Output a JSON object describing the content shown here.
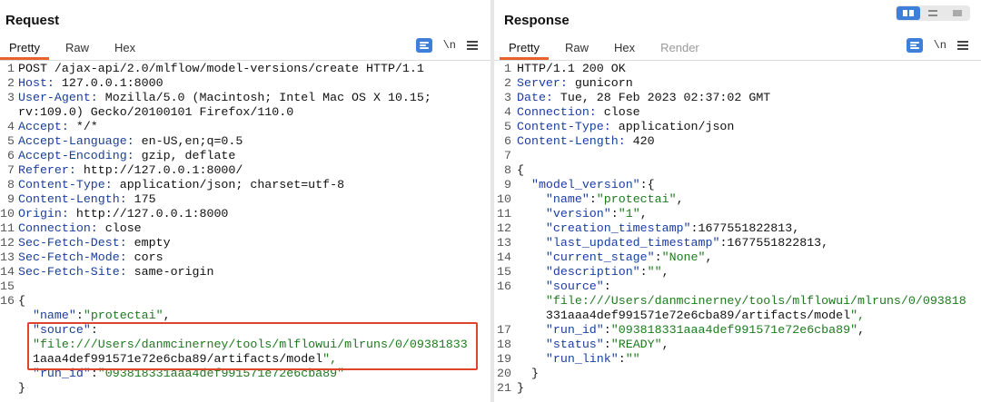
{
  "request": {
    "title": "Request",
    "tabs": [
      "Pretty",
      "Raw",
      "Hex"
    ],
    "active_tab": "Pretty",
    "newline_label": "\\n",
    "lines": [
      {
        "n": "1",
        "t": "POST /ajax-api/2.0/mlflow/model-versions/create HTTP/1.1"
      },
      {
        "n": "2",
        "t": "Host: 127.0.0.1:8000"
      },
      {
        "n": "3",
        "t": "User-Agent: Mozilla/5.0 (Macintosh; Intel Mac OS X 10.15;"
      },
      {
        "n": "",
        "t": "rv:109.0) Gecko/20100101 Firefox/110.0"
      },
      {
        "n": "4",
        "t": "Accept: */*"
      },
      {
        "n": "5",
        "t": "Accept-Language: en-US,en;q=0.5"
      },
      {
        "n": "6",
        "t": "Accept-Encoding: gzip, deflate"
      },
      {
        "n": "7",
        "t": "Referer: http://127.0.0.1:8000/"
      },
      {
        "n": "8",
        "t": "Content-Type: application/json; charset=utf-8"
      },
      {
        "n": "9",
        "t": "Content-Length: 175"
      },
      {
        "n": "10",
        "t": "Origin: http://127.0.0.1:8000"
      },
      {
        "n": "11",
        "t": "Connection: close"
      },
      {
        "n": "12",
        "t": "Sec-Fetch-Dest: empty"
      },
      {
        "n": "13",
        "t": "Sec-Fetch-Mode: cors"
      },
      {
        "n": "14",
        "t": "Sec-Fetch-Site: same-origin"
      },
      {
        "n": "15",
        "t": ""
      },
      {
        "n": "16",
        "t": "{"
      },
      {
        "n": "",
        "t": "  \"name\":\"protectai\","
      },
      {
        "n": "",
        "t": "  \"source\":"
      },
      {
        "n": "",
        "t": "  \"file:///Users/danmcinerney/tools/mlflowui/mlruns/0/09381833"
      },
      {
        "n": "",
        "t": "  1aaa4def991571e72e6cba89/artifacts/model\","
      },
      {
        "n": "",
        "t": "  \"run_id\":\"093818331aaa4def991571e72e6cba89\""
      },
      {
        "n": "",
        "t": "}"
      }
    ]
  },
  "response": {
    "title": "Response",
    "tabs": [
      "Pretty",
      "Raw",
      "Hex",
      "Render"
    ],
    "active_tab": "Pretty",
    "newline_label": "\\n",
    "lines": [
      {
        "n": "1",
        "t": "HTTP/1.1 200 OK"
      },
      {
        "n": "2",
        "t": "Server: gunicorn"
      },
      {
        "n": "3",
        "t": "Date: Tue, 28 Feb 2023 02:37:02 GMT"
      },
      {
        "n": "4",
        "t": "Connection: close"
      },
      {
        "n": "5",
        "t": "Content-Type: application/json"
      },
      {
        "n": "6",
        "t": "Content-Length: 420"
      },
      {
        "n": "7",
        "t": ""
      },
      {
        "n": "8",
        "t": "{"
      },
      {
        "n": "9",
        "t": "  \"model_version\":{"
      },
      {
        "n": "10",
        "t": "    \"name\":\"protectai\","
      },
      {
        "n": "11",
        "t": "    \"version\":\"1\","
      },
      {
        "n": "12",
        "t": "    \"creation_timestamp\":1677551822813,"
      },
      {
        "n": "13",
        "t": "    \"last_updated_timestamp\":1677551822813,"
      },
      {
        "n": "14",
        "t": "    \"current_stage\":\"None\","
      },
      {
        "n": "15",
        "t": "    \"description\":\"\","
      },
      {
        "n": "16",
        "t": "    \"source\":"
      },
      {
        "n": "",
        "t": "    \"file:///Users/danmcinerney/tools/mlflowui/mlruns/0/093818"
      },
      {
        "n": "",
        "t": "    331aaa4def991571e72e6cba89/artifacts/model\","
      },
      {
        "n": "17",
        "t": "    \"run_id\":\"093818331aaa4def991571e72e6cba89\","
      },
      {
        "n": "18",
        "t": "    \"status\":\"READY\","
      },
      {
        "n": "19",
        "t": "    \"run_link\":\"\""
      },
      {
        "n": "20",
        "t": "  }"
      },
      {
        "n": "21",
        "t": "}"
      }
    ]
  },
  "colors": {
    "accent_tab": "#e8632b",
    "highlight_border": "#e0442b",
    "header_key": "#1a3e9e",
    "json_string": "#1e7a1e",
    "toolbar_button": "#3d7fd9"
  }
}
